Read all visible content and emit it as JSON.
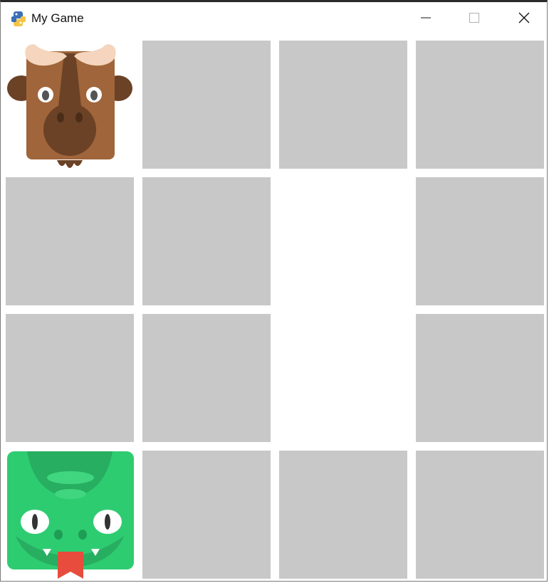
{
  "window": {
    "title": "My Game",
    "app_icon": "python-snake-icon",
    "controls": [
      "minimize-icon",
      "maximize-icon",
      "close-icon"
    ]
  },
  "board": {
    "rows": 4,
    "cols": 4,
    "hidden_color": "#c8c8c8",
    "tiles": [
      [
        "buffalo",
        "hidden",
        "hidden",
        "hidden"
      ],
      [
        "hidden",
        "hidden",
        "empty",
        "hidden"
      ],
      [
        "hidden",
        "hidden",
        "empty",
        "hidden"
      ],
      [
        "crocodile",
        "hidden",
        "hidden",
        "hidden"
      ]
    ]
  },
  "colors": {
    "buffalo_body": "#a0653a",
    "buffalo_dark": "#6b4226",
    "buffalo_horn": "#f5d5bd",
    "crocodile_body": "#2ecc71",
    "crocodile_dark": "#27ae60",
    "crocodile_tongue": "#e74c3c"
  }
}
